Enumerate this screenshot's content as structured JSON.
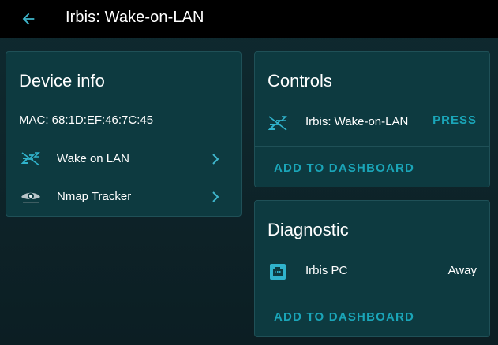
{
  "header": {
    "back_icon": "arrow-left-icon",
    "title": "Irbis: Wake-on-LAN"
  },
  "device_info": {
    "title": "Device info",
    "mac": "MAC: 68:1D:EF:46:7C:45",
    "links": [
      {
        "label": "Wake on LAN",
        "icon": "wake-on-lan-icon"
      },
      {
        "label": "Nmap Tracker",
        "icon": "nmap-eye-icon"
      }
    ]
  },
  "controls": {
    "title": "Controls",
    "entity": {
      "label": "Irbis: Wake-on-LAN",
      "icon": "sleep-zzz-icon",
      "action": "PRESS"
    },
    "add_label": "ADD TO DASHBOARD"
  },
  "diagnostic": {
    "title": "Diagnostic",
    "entity": {
      "label": "Irbis PC",
      "icon": "ethernet-port-icon",
      "state": "Away"
    },
    "add_label": "ADD TO DASHBOARD"
  },
  "colors": {
    "header_bg": "#000000",
    "card_bg": "#0d3a40",
    "accent": "#1aa5b8",
    "icon_accent": "#30b3cc"
  }
}
